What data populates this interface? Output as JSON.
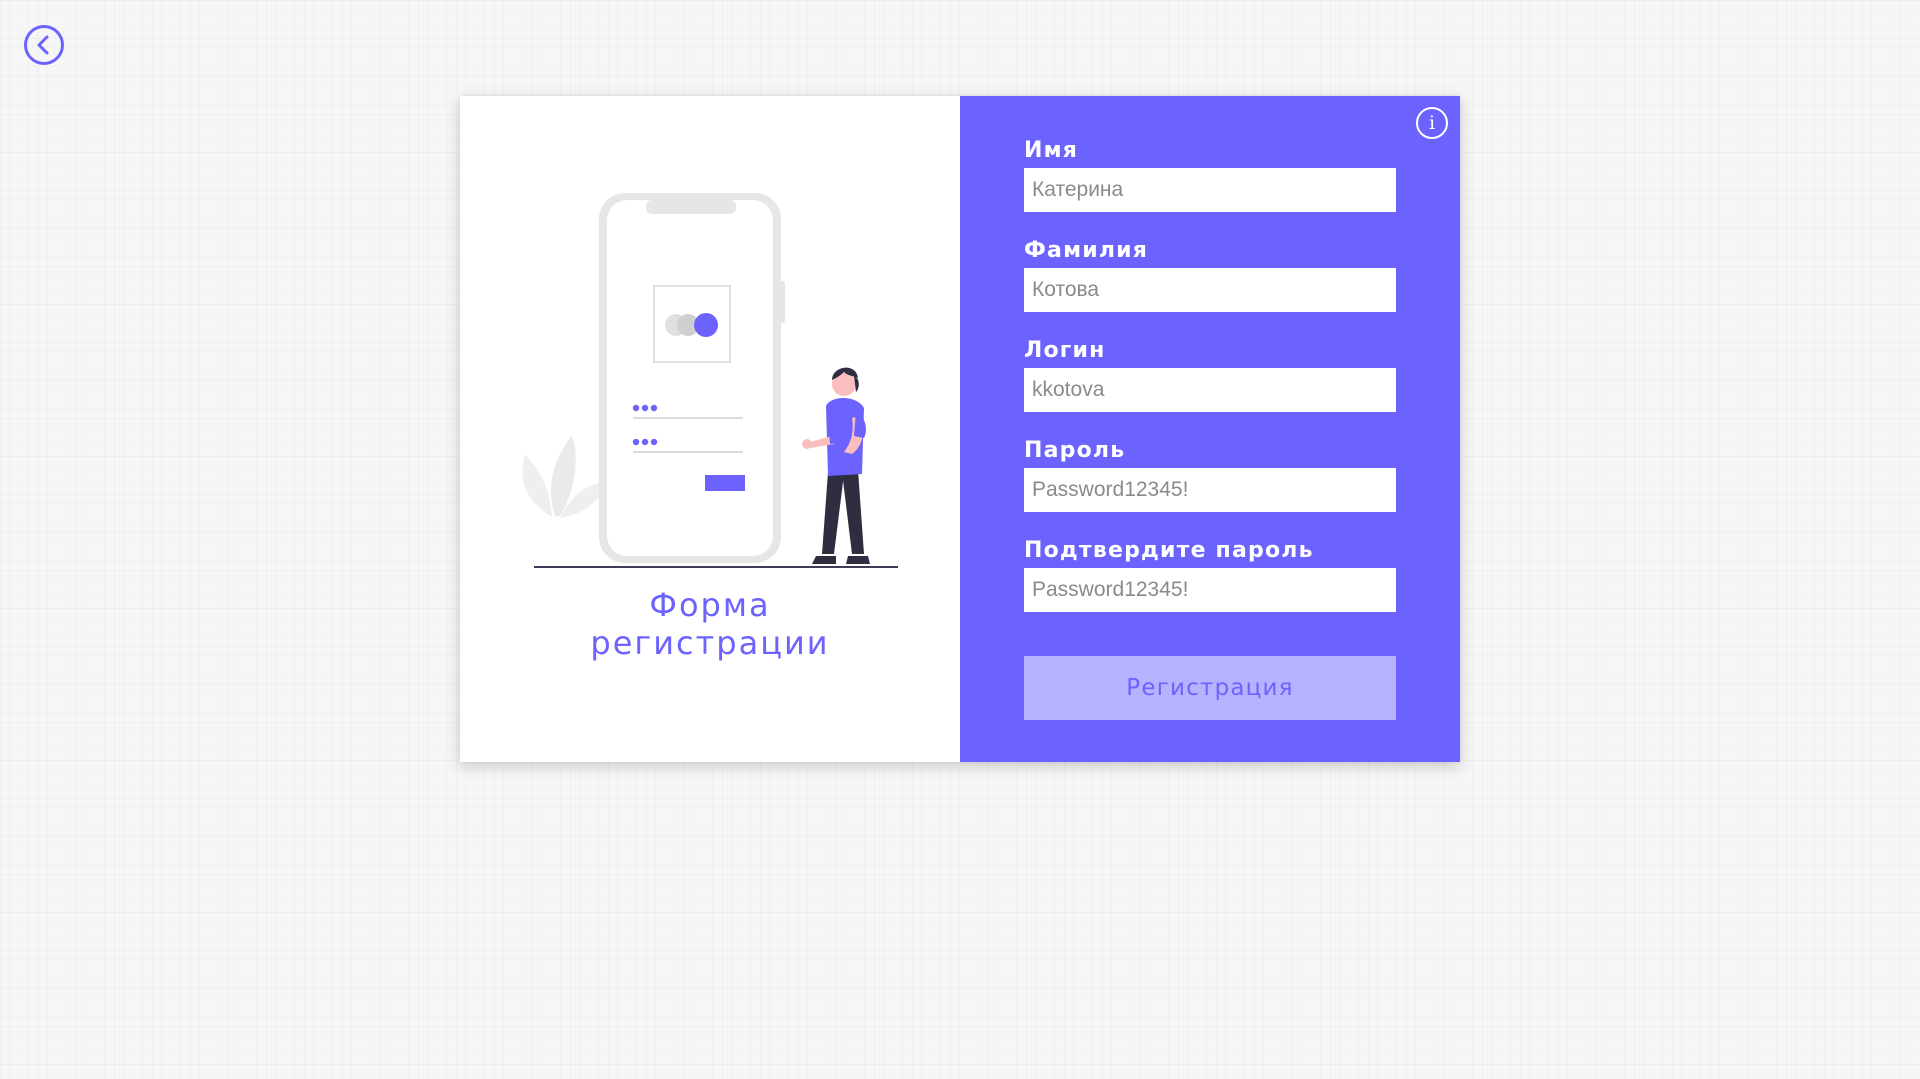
{
  "colors": {
    "accent": "#6c63ff",
    "accent_light": "#b6b2ff",
    "panel_left": "#ffffff",
    "page_background": "#f6f6f6"
  },
  "icons": {
    "back": "chevron-left-circle-icon",
    "info": "info-circle-icon"
  },
  "info": {
    "glyph": "i"
  },
  "left_panel": {
    "title_line1": "Форма",
    "title_line2": "регистрации"
  },
  "form": {
    "fields": [
      {
        "label": "Имя",
        "placeholder": "Катерина",
        "value": ""
      },
      {
        "label": "Фамилия",
        "placeholder": "Котова",
        "value": ""
      },
      {
        "label": "Логин",
        "placeholder": "kkotova",
        "value": ""
      },
      {
        "label": "Пароль",
        "placeholder": "Password12345!",
        "value": ""
      },
      {
        "label": "Подтвердите пароль",
        "placeholder": "Password12345!",
        "value": ""
      }
    ],
    "submit_label": "Регистрация"
  }
}
